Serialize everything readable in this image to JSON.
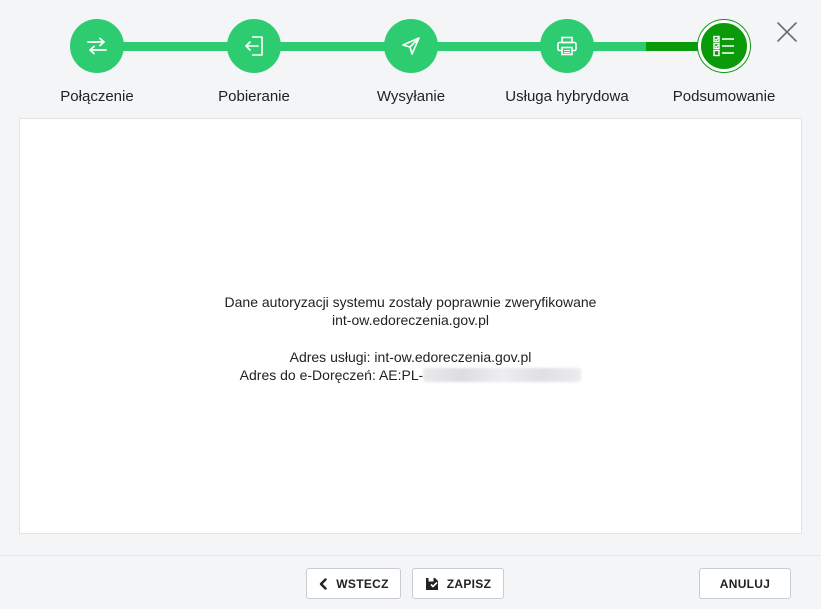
{
  "steps": [
    {
      "label": "Połączenie",
      "icon": "transfer-arrows-icon",
      "state": "done"
    },
    {
      "label": "Pobieranie",
      "icon": "sign-in-icon",
      "state": "done"
    },
    {
      "label": "Wysyłanie",
      "icon": "send-plane-icon",
      "state": "done"
    },
    {
      "label": "Usługa hybrydowa",
      "icon": "printer-icon",
      "state": "done"
    },
    {
      "label": "Podsumowanie",
      "icon": "checklist-icon",
      "state": "active"
    }
  ],
  "message": {
    "line1": "Dane autoryzacji systemu zostały poprawnie zweryfikowane",
    "line2": "int-ow.edoreczenia.gov.pl",
    "service_address": "Adres usługi: int-ow.edoreczenia.gov.pl",
    "edelivery_prefix": "Adres do e-Doręczeń: AE:PL-"
  },
  "buttons": {
    "back": "WSTECZ",
    "save": "ZAPISZ",
    "cancel": "ANULUJ"
  },
  "colors": {
    "step_done": "#2ecc71",
    "step_active": "#0a9a0a"
  }
}
